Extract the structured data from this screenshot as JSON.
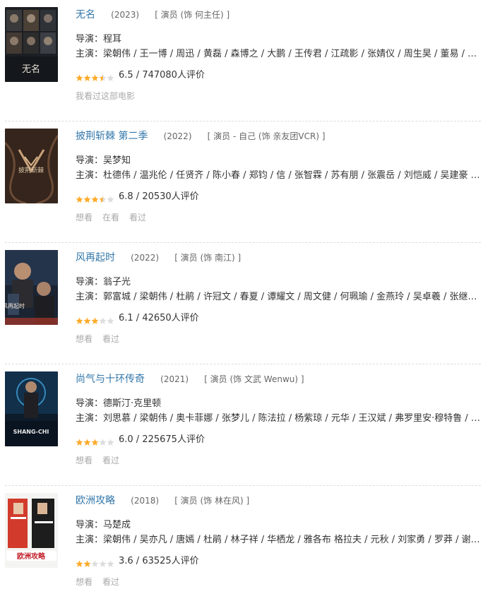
{
  "colors": {
    "link": "#3377aa",
    "star_full": "#ffac2d",
    "star_empty": "#dddddd"
  },
  "movies": [
    {
      "title": "无名",
      "year": "(2023)",
      "role": "[ 演员 (饰 何主任) ]",
      "director_label": "导演：",
      "director": "程耳",
      "cast_label": "主演：",
      "cast": "梁朝伟 / 王一博 / 周迅 / 黄磊 / 森博之 / 大鹏 / 王传君 / 江疏影 / 张婧仪 / 周生昊 / 董易 / 古川...",
      "stars": 3.5,
      "rating_text": "6.5 / 747080人评价",
      "actions": [
        "我看过这部电影"
      ]
    },
    {
      "title": "披荆斩棘 第二季",
      "year": "(2022)",
      "role": "[ 演员 - 自己 (饰 亲友团VCR) ]",
      "director_label": "导演：",
      "director": "吴梦知",
      "cast_label": "主演：",
      "cast": "杜德伟 / 温兆伦 / 任贤齐 / 陈小春 / 郑钧 / 信 / 张智霖 / 苏有朋 / 张震岳 / 刘恺威 / 吴建豪 / 郝...",
      "stars": 3.5,
      "rating_text": "6.8 / 20530人评价",
      "actions": [
        "想看",
        "在看",
        "看过"
      ]
    },
    {
      "title": "风再起时",
      "year": "(2022)",
      "role": "[ 演员 (饰 南江) ]",
      "director_label": "导演：",
      "director": "翁子光",
      "cast_label": "主演：",
      "cast": "郭富城 / 梁朝伟 / 杜鹃 / 许冠文 / 春夏 / 谭耀文 / 周文健 / 何珮瑜 / 金燕玲 / 吴卓羲 / 张继聪 / ...",
      "stars": 3,
      "rating_text": "6.1 / 42650人评价",
      "actions": [
        "想看",
        "看过"
      ]
    },
    {
      "title": "尚气与十环传奇",
      "year": "(2021)",
      "role": "[ 演员 (饰 文武 Wenwu) ]",
      "director_label": "导演：",
      "director": "德斯汀·克里顿",
      "cast_label": "主演：",
      "cast": "刘思慕 / 梁朝伟 / 奥卡菲娜 / 张梦儿 / 陈法拉 / 杨紫琼 / 元华 / 王汉斌 / 弗罗里安·穆特鲁 / 黎...",
      "stars": 3,
      "rating_text": "6.0 / 225675人评价",
      "actions": [
        "想看",
        "看过"
      ]
    },
    {
      "title": "欧洲攻略",
      "year": "(2018)",
      "role": "[ 演员 (饰 林在风) ]",
      "director_label": "导演：",
      "director": "马楚成",
      "cast_label": "主演：",
      "cast": "梁朝伟 / 吴亦凡 / 唐嫣 / 杜鹃 / 林子祥 / 华栖龙 / 雅各布 格拉夫 / 元秋 / 刘家勇 / 罗莽 / 谢婷...",
      "stars": 2,
      "rating_text": "3.6 / 63525人评价",
      "actions": [
        "想看",
        "看过"
      ]
    }
  ],
  "posters": [
    {
      "text": "无名"
    },
    {
      "text": "披荆斩棘"
    },
    {
      "text": "风再起时"
    },
    {
      "text": "SHANG-CHI"
    },
    {
      "text": "欧洲攻略"
    }
  ]
}
